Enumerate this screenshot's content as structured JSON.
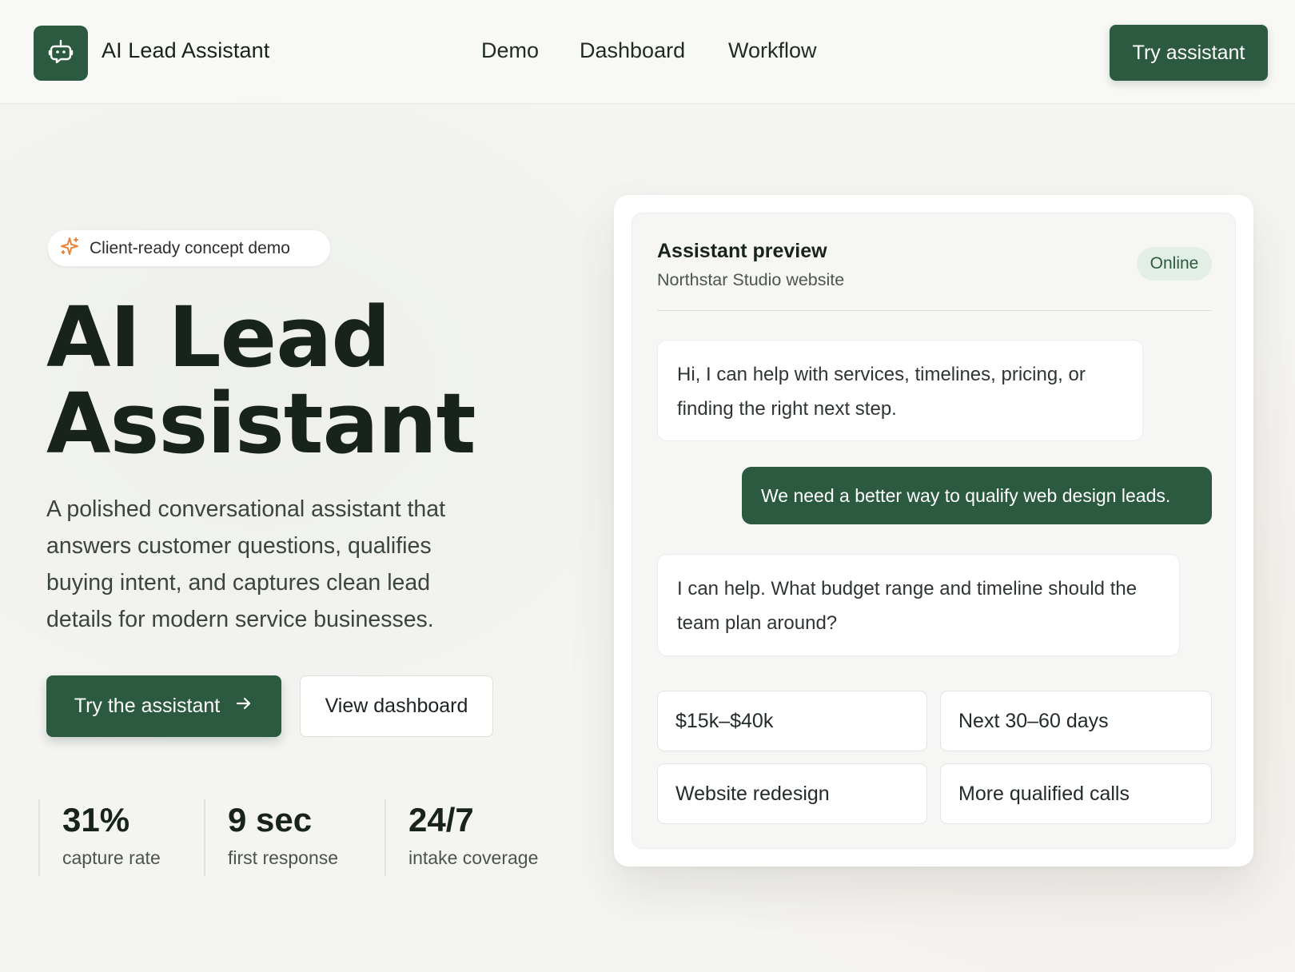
{
  "header": {
    "brand_name": "AI Lead Assistant",
    "nav": [
      "Demo",
      "Dashboard",
      "Workflow"
    ],
    "cta": "Try assistant"
  },
  "hero": {
    "pill_text": "Client-ready concept demo",
    "title_line1": "AI Lead",
    "title_line2": "Assistant",
    "description": "A polished conversational assistant that answers customer questions, qualifies buying intent, and captures clean lead details for modern service businesses.",
    "primary_button": "Try the assistant",
    "secondary_button": "View dashboard",
    "stats": [
      {
        "value": "31%",
        "label": "capture rate"
      },
      {
        "value": "9 sec",
        "label": "first response"
      },
      {
        "value": "24/7",
        "label": "intake coverage"
      }
    ]
  },
  "assistant": {
    "title": "Assistant preview",
    "subtitle": "Northstar Studio website",
    "status": "Online",
    "messages": [
      {
        "role": "bot",
        "text": "Hi, I can help with services, timelines, pricing, or finding the right next step."
      },
      {
        "role": "user",
        "text": "We need a better way to qualify web design leads."
      },
      {
        "role": "bot",
        "text": "I can help. What budget range and timeline should the team plan around?"
      }
    ],
    "quick_replies": [
      "$15k–$40k",
      "Next 30–60 days",
      "Website redesign",
      "More qualified calls"
    ]
  },
  "colors": {
    "brand_green": "#2b5a41",
    "badge_bg": "#e3efe6",
    "accent_orange": "#e8833a"
  },
  "icons": {
    "logo": "robot-chat-icon",
    "pill": "sparkle-icon",
    "primary_button": "arrow-right-icon"
  }
}
